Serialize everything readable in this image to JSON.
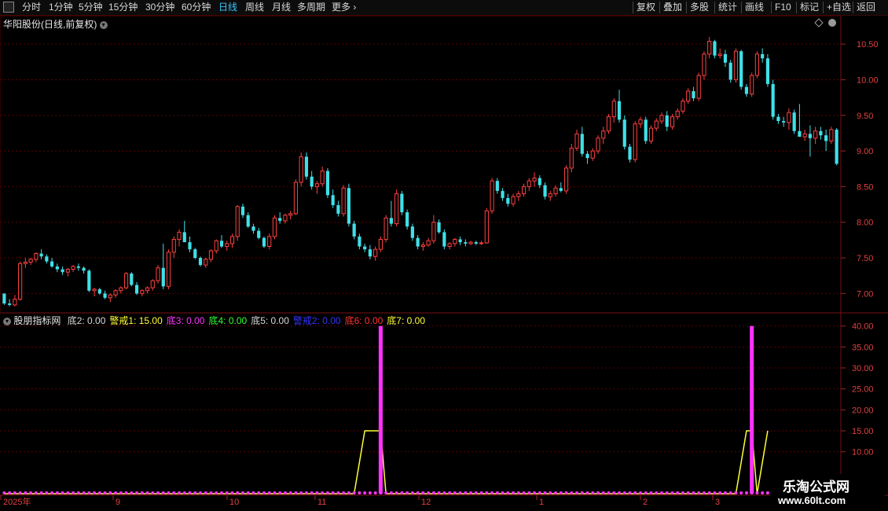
{
  "toolbar": {
    "left_items": [
      "分时",
      "1分钟",
      "5分钟",
      "15分钟",
      "30分钟",
      "60分钟",
      "日线",
      "周线",
      "月线",
      "多周期",
      "更多"
    ],
    "active": "日线",
    "right_items": [
      "复权",
      "叠加",
      "多股",
      "统计",
      "画线",
      "F10",
      "标记",
      "+自选",
      "返回"
    ]
  },
  "stock": {
    "title": "华阳股份(日线,前复权)"
  },
  "price_axis": {
    "ticks": [
      "10.50",
      "10.00",
      "9.50",
      "9.00",
      "8.50",
      "8.00",
      "7.50",
      "7.00"
    ]
  },
  "indicator": {
    "name": "股朋指标网",
    "legend": [
      {
        "label": "底2: 0.00",
        "color": "#d8d8d8"
      },
      {
        "label": "警戒1: 15.00",
        "color": "#ffff33"
      },
      {
        "label": "底3: 0.00",
        "color": "#ff33ff"
      },
      {
        "label": "底4: 0.00",
        "color": "#33ff33"
      },
      {
        "label": "底5: 0.00",
        "color": "#d8d8d8"
      },
      {
        "label": "警戒2: 0.00",
        "color": "#3333ff"
      },
      {
        "label": "底6: 0.00",
        "color": "#ff3333"
      },
      {
        "label": "底7: 0.00",
        "color": "#ffff33"
      }
    ],
    "axis_ticks": [
      "40.00",
      "35.00",
      "30.00",
      "25.00",
      "20.00",
      "15.00",
      "10.00"
    ]
  },
  "date_axis": {
    "labels": [
      "2025年",
      "9",
      "10",
      "11",
      "12",
      "1",
      "2",
      "3"
    ]
  },
  "watermark": {
    "line1": "乐淘公式网",
    "line2": "www.60lt.com"
  },
  "colors": {
    "up": "#ff4040",
    "down": "#40e0e8",
    "grid": "#5a0000",
    "alert": "#ffff33",
    "spike": "#ff33ff"
  },
  "chart_data": {
    "type": "candlestick",
    "ylim": [
      6.75,
      10.7
    ],
    "period_labels": [
      "2025年",
      "9",
      "10",
      "11",
      "12",
      "1",
      "2",
      "3"
    ],
    "ohlc": [
      [
        7.0,
        7.0,
        6.84,
        6.86
      ],
      [
        6.86,
        6.92,
        6.82,
        6.84
      ],
      [
        6.84,
        6.98,
        6.82,
        6.92
      ],
      [
        6.92,
        7.45,
        6.9,
        7.42
      ],
      [
        7.42,
        7.5,
        7.36,
        7.44
      ],
      [
        7.44,
        7.5,
        7.4,
        7.48
      ],
      [
        7.48,
        7.58,
        7.44,
        7.56
      ],
      [
        7.56,
        7.62,
        7.48,
        7.52
      ],
      [
        7.52,
        7.55,
        7.42,
        7.45
      ],
      [
        7.45,
        7.5,
        7.36,
        7.38
      ],
      [
        7.38,
        7.42,
        7.3,
        7.34
      ],
      [
        7.34,
        7.38,
        7.26,
        7.3
      ],
      [
        7.3,
        7.36,
        7.24,
        7.34
      ],
      [
        7.34,
        7.4,
        7.3,
        7.38
      ],
      [
        7.38,
        7.42,
        7.32,
        7.36
      ],
      [
        7.36,
        7.38,
        7.28,
        7.32
      ],
      [
        7.32,
        7.34,
        7.02,
        7.04
      ],
      [
        7.04,
        7.08,
        6.96,
        7.06
      ],
      [
        7.06,
        7.08,
        6.98,
        7.0
      ],
      [
        7.0,
        7.04,
        6.92,
        6.94
      ],
      [
        6.94,
        7.0,
        6.88,
        6.98
      ],
      [
        6.98,
        7.06,
        6.94,
        7.04
      ],
      [
        7.04,
        7.1,
        7.0,
        7.08
      ],
      [
        7.08,
        7.3,
        7.06,
        7.28
      ],
      [
        7.28,
        7.3,
        7.1,
        7.12
      ],
      [
        7.12,
        7.16,
        6.98,
        7.0
      ],
      [
        7.0,
        7.06,
        6.96,
        7.04
      ],
      [
        7.04,
        7.1,
        7.0,
        7.08
      ],
      [
        7.08,
        7.2,
        7.04,
        7.18
      ],
      [
        7.18,
        7.4,
        7.14,
        7.36
      ],
      [
        7.36,
        7.7,
        7.06,
        7.1
      ],
      [
        7.1,
        7.62,
        7.06,
        7.58
      ],
      [
        7.58,
        7.8,
        7.5,
        7.76
      ],
      [
        7.76,
        7.9,
        7.66,
        7.86
      ],
      [
        7.86,
        8.02,
        7.78,
        7.72
      ],
      [
        7.72,
        7.8,
        7.58,
        7.62
      ],
      [
        7.62,
        7.64,
        7.48,
        7.5
      ],
      [
        7.5,
        7.52,
        7.38,
        7.4
      ],
      [
        7.4,
        7.5,
        7.36,
        7.48
      ],
      [
        7.48,
        7.62,
        7.44,
        7.6
      ],
      [
        7.6,
        7.76,
        7.56,
        7.74
      ],
      [
        7.74,
        7.82,
        7.64,
        7.66
      ],
      [
        7.66,
        7.74,
        7.6,
        7.7
      ],
      [
        7.7,
        7.84,
        7.64,
        7.8
      ],
      [
        7.8,
        8.24,
        7.74,
        8.22
      ],
      [
        8.22,
        8.26,
        8.06,
        8.1
      ],
      [
        8.1,
        8.14,
        7.92,
        7.94
      ],
      [
        7.94,
        7.98,
        7.84,
        7.88
      ],
      [
        7.88,
        7.92,
        7.76,
        7.78
      ],
      [
        7.78,
        7.8,
        7.64,
        7.66
      ],
      [
        7.66,
        7.84,
        7.62,
        7.8
      ],
      [
        7.8,
        8.1,
        7.76,
        8.06
      ],
      [
        8.06,
        8.14,
        7.98,
        8.02
      ],
      [
        8.02,
        8.12,
        7.98,
        8.1
      ],
      [
        8.1,
        8.16,
        8.04,
        8.12
      ],
      [
        8.12,
        8.6,
        8.1,
        8.56
      ],
      [
        8.56,
        8.98,
        8.5,
        8.92
      ],
      [
        8.92,
        8.98,
        8.6,
        8.64
      ],
      [
        8.64,
        8.72,
        8.46,
        8.5
      ],
      [
        8.5,
        8.58,
        8.4,
        8.54
      ],
      [
        8.54,
        8.78,
        8.5,
        8.72
      ],
      [
        8.72,
        8.76,
        8.34,
        8.38
      ],
      [
        8.38,
        8.46,
        8.2,
        8.24
      ],
      [
        8.24,
        8.3,
        8.08,
        8.12
      ],
      [
        8.12,
        8.52,
        8.08,
        8.48
      ],
      [
        8.48,
        8.54,
        7.94,
        7.98
      ],
      [
        7.98,
        8.02,
        7.76,
        7.8
      ],
      [
        7.8,
        7.84,
        7.62,
        7.66
      ],
      [
        7.66,
        7.7,
        7.58,
        7.62
      ],
      [
        7.62,
        7.68,
        7.48,
        7.52
      ],
      [
        7.52,
        7.66,
        7.46,
        7.62
      ],
      [
        7.62,
        7.8,
        7.58,
        7.76
      ],
      [
        7.76,
        8.1,
        7.72,
        8.06
      ],
      [
        8.06,
        8.3,
        7.94,
        7.98
      ],
      [
        7.98,
        8.46,
        7.94,
        8.4
      ],
      [
        8.4,
        8.44,
        8.1,
        8.14
      ],
      [
        8.14,
        8.18,
        7.9,
        7.94
      ],
      [
        7.94,
        7.98,
        7.74,
        7.78
      ],
      [
        7.78,
        7.82,
        7.62,
        7.66
      ],
      [
        7.66,
        7.72,
        7.6,
        7.68
      ],
      [
        7.68,
        7.78,
        7.66,
        7.74
      ],
      [
        7.74,
        8.1,
        7.7,
        8.0
      ],
      [
        8.0,
        8.04,
        7.84,
        7.86
      ],
      [
        7.86,
        7.9,
        7.62,
        7.66
      ],
      [
        7.66,
        7.72,
        7.62,
        7.7
      ],
      [
        7.7,
        7.78,
        7.66,
        7.76
      ],
      [
        7.76,
        7.8,
        7.68,
        7.72
      ],
      [
        7.72,
        7.76,
        7.66,
        7.7
      ],
      [
        7.7,
        7.74,
        7.68,
        7.72
      ],
      [
        7.72,
        7.74,
        7.68,
        7.7
      ],
      [
        7.7,
        7.74,
        7.68,
        7.71
      ],
      [
        7.71,
        8.2,
        7.7,
        8.16
      ],
      [
        8.16,
        8.62,
        8.12,
        8.58
      ],
      [
        8.58,
        8.62,
        8.4,
        8.44
      ],
      [
        8.44,
        8.48,
        8.3,
        8.34
      ],
      [
        8.34,
        8.4,
        8.22,
        8.26
      ],
      [
        8.26,
        8.4,
        8.22,
        8.36
      ],
      [
        8.36,
        8.44,
        8.3,
        8.4
      ],
      [
        8.4,
        8.54,
        8.36,
        8.5
      ],
      [
        8.5,
        8.62,
        8.44,
        8.58
      ],
      [
        8.58,
        8.7,
        8.5,
        8.62
      ],
      [
        8.62,
        8.66,
        8.48,
        8.52
      ],
      [
        8.52,
        8.56,
        8.32,
        8.36
      ],
      [
        8.36,
        8.44,
        8.3,
        8.4
      ],
      [
        8.4,
        8.52,
        8.36,
        8.48
      ],
      [
        8.48,
        8.56,
        8.42,
        8.44
      ],
      [
        8.44,
        8.8,
        8.4,
        8.76
      ],
      [
        8.76,
        9.1,
        8.7,
        9.04
      ],
      [
        9.04,
        9.3,
        9.0,
        9.24
      ],
      [
        9.24,
        9.34,
        8.92,
        8.96
      ],
      [
        8.96,
        9.0,
        8.82,
        8.9
      ],
      [
        8.9,
        9.04,
        8.86,
        9.0
      ],
      [
        9.0,
        9.22,
        8.96,
        9.18
      ],
      [
        9.18,
        9.34,
        9.1,
        9.28
      ],
      [
        9.28,
        9.52,
        9.24,
        9.48
      ],
      [
        9.48,
        9.74,
        9.4,
        9.7
      ],
      [
        9.7,
        9.86,
        9.4,
        9.44
      ],
      [
        9.44,
        9.5,
        9.02,
        9.06
      ],
      [
        9.06,
        9.1,
        8.84,
        8.88
      ],
      [
        8.88,
        9.42,
        8.84,
        9.38
      ],
      [
        9.38,
        9.48,
        9.32,
        9.44
      ],
      [
        9.44,
        9.48,
        9.1,
        9.14
      ],
      [
        9.14,
        9.36,
        9.1,
        9.32
      ],
      [
        9.32,
        9.46,
        9.28,
        9.42
      ],
      [
        9.42,
        9.54,
        9.38,
        9.5
      ],
      [
        9.5,
        9.56,
        9.28,
        9.34
      ],
      [
        9.34,
        9.52,
        9.3,
        9.48
      ],
      [
        9.48,
        9.6,
        9.44,
        9.56
      ],
      [
        9.56,
        9.74,
        9.52,
        9.7
      ],
      [
        9.7,
        9.88,
        9.66,
        9.84
      ],
      [
        9.84,
        9.9,
        9.7,
        9.74
      ],
      [
        9.74,
        10.1,
        9.7,
        10.06
      ],
      [
        10.06,
        10.4,
        10.0,
        10.36
      ],
      [
        10.36,
        10.6,
        10.3,
        10.54
      ],
      [
        10.54,
        10.56,
        10.3,
        10.34
      ],
      [
        10.34,
        10.44,
        10.3,
        10.36
      ],
      [
        10.36,
        10.42,
        10.18,
        10.24
      ],
      [
        10.24,
        10.28,
        9.96,
        10.0
      ],
      [
        10.0,
        10.44,
        9.96,
        10.4
      ],
      [
        10.4,
        10.42,
        9.86,
        9.9
      ],
      [
        9.9,
        9.94,
        9.76,
        9.8
      ],
      [
        9.8,
        10.1,
        9.76,
        10.06
      ],
      [
        10.06,
        10.4,
        10.02,
        10.36
      ],
      [
        10.36,
        10.44,
        10.24,
        10.3
      ],
      [
        10.3,
        10.36,
        9.9,
        9.94
      ],
      [
        9.94,
        10.0,
        9.44,
        9.48
      ],
      [
        9.48,
        9.52,
        9.38,
        9.42
      ],
      [
        9.42,
        9.48,
        9.34,
        9.4
      ],
      [
        9.4,
        9.6,
        9.3,
        9.54
      ],
      [
        9.54,
        9.58,
        9.24,
        9.28
      ],
      [
        9.28,
        9.66,
        9.24,
        9.2
      ],
      [
        9.2,
        9.3,
        9.14,
        9.24
      ],
      [
        9.24,
        9.36,
        8.92,
        9.18
      ],
      [
        9.18,
        9.34,
        9.1,
        9.28
      ],
      [
        9.28,
        9.34,
        9.16,
        9.22
      ],
      [
        9.22,
        9.3,
        9.0,
        9.14
      ],
      [
        9.14,
        9.34,
        9.1,
        9.3
      ],
      [
        9.3,
        9.32,
        8.8,
        8.82
      ]
    ],
    "indicator_series": [
      {
        "name": "警戒1",
        "type": "line",
        "color": "#ffff33",
        "points": [
          [
            0,
            0
          ],
          [
            66,
            0
          ],
          [
            68,
            15
          ],
          [
            71,
            15
          ],
          [
            72,
            0
          ],
          [
            138,
            0
          ],
          [
            140,
            15
          ],
          [
            141,
            15
          ],
          [
            142,
            0
          ],
          [
            144,
            15
          ]
        ]
      },
      {
        "name": "底3",
        "type": "spike",
        "color": "#ff33ff",
        "x_index": [
          71,
          141
        ],
        "value": 40
      },
      {
        "name": "底3 baseline",
        "type": "dots",
        "color": "#ff33ff",
        "value": 0
      }
    ],
    "indicator_ylim": [
      0,
      42
    ]
  }
}
